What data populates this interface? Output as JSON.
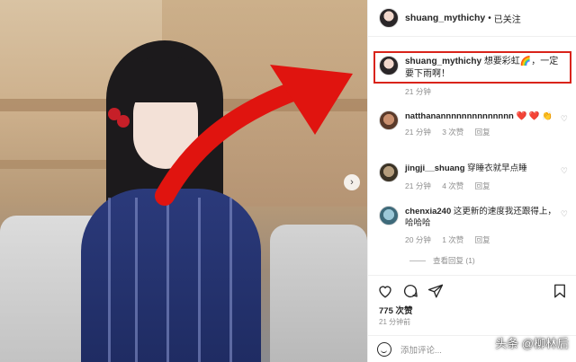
{
  "header": {
    "username": "shuang_mythichy",
    "dot": "•",
    "follow_status": "已关注"
  },
  "caption": {
    "username": "shuang_mythichy",
    "text": "想要彩虹🌈，一定要下雨啊！",
    "time": "21 分钟"
  },
  "comments": [
    {
      "username": "natthanannnnnnnnnnnnnn",
      "text": "❤️ ❤️ 👏",
      "time": "21 分钟",
      "likes": "3 次赞",
      "reply": "回复"
    },
    {
      "username": "jingji__shuang",
      "text": "穿睡衣就早点睡",
      "time": "21 分钟",
      "likes": "4 次赞",
      "reply": "回复"
    },
    {
      "username": "chenxia240",
      "text": "这更新的速度我还跟得上，哈哈哈",
      "time": "20 分钟",
      "likes": "1 次赞",
      "reply": "回复"
    }
  ],
  "view_replies": "查看回复 (1)",
  "likes_count": "775 次赞",
  "posted_ago": "21 分钟前",
  "add_comment_placeholder": "添加评论...",
  "watermark": "头条 @柳林后",
  "icons": {
    "like": "heart-icon",
    "comment": "comment-icon",
    "share": "share-icon",
    "save": "bookmark-icon",
    "next": "chevron-right-icon",
    "emoji": "smile-icon"
  },
  "colors": {
    "highlight": "#d9231a",
    "arrow": "#e0140f",
    "text": "#262626",
    "muted": "#8e8e8e"
  }
}
